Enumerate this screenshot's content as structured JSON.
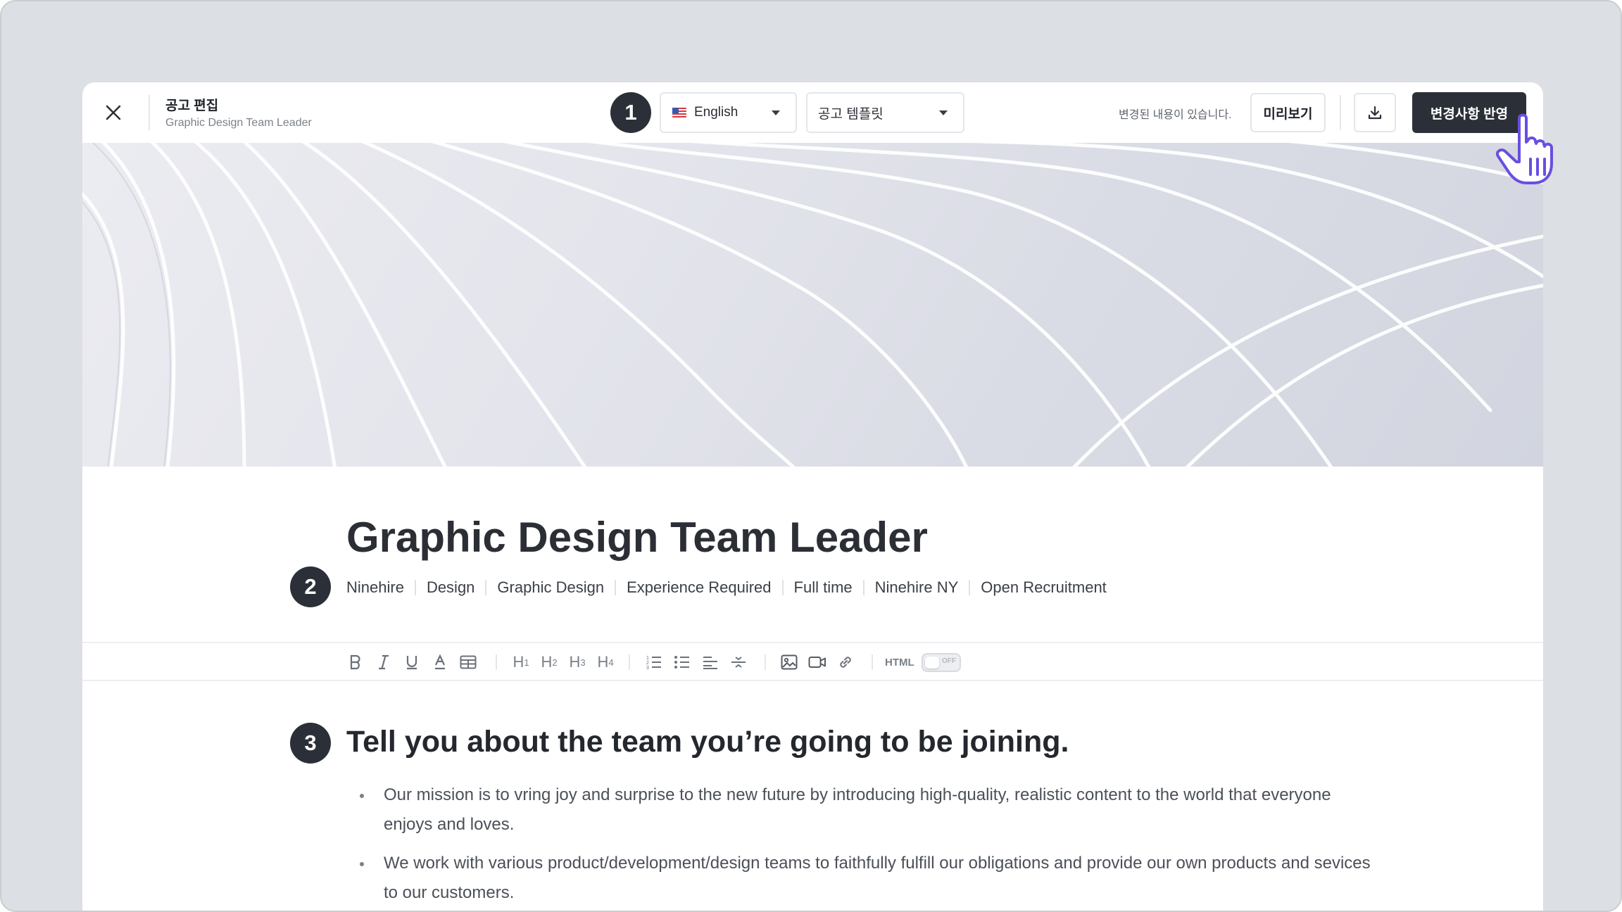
{
  "header": {
    "title": "공고 편집",
    "subtitle": "Graphic Design Team Leader",
    "language": {
      "label": "English",
      "flag": "us-flag-icon"
    },
    "template": {
      "label": "공고 템플릿"
    },
    "changes_note": "변경된 내용이 있습니다.",
    "preview_label": "미리보기",
    "apply_label": "변경사항 반영"
  },
  "steps": [
    "1",
    "2",
    "3"
  ],
  "job": {
    "title": "Graphic Design Team Leader",
    "tags": [
      "Ninehire",
      "Design",
      "Graphic Design",
      "Experience Required",
      "Full time",
      "Ninehire NY",
      "Open Recruitment"
    ]
  },
  "toolbar": {
    "headings": [
      {
        "main": "H",
        "sub": "1"
      },
      {
        "main": "H",
        "sub": "2"
      },
      {
        "main": "H",
        "sub": "3"
      },
      {
        "main": "H",
        "sub": "4"
      }
    ],
    "html_label": "HTML",
    "toggle_state": "OFF"
  },
  "content": {
    "heading": "Tell you about the team you’re going to be joining.",
    "bullets": [
      "Our mission is to vring joy and surprise to the new future by introducing high-quality, realistic content to the world that everyone enjoys and loves.",
      "We work with various product/development/design teams to faithfully fulfill our obligations and provide our own products and sevices to our customers."
    ]
  },
  "colors": {
    "primary_dark": "#2b3038",
    "accent_cursor": "#6a4ee0"
  }
}
